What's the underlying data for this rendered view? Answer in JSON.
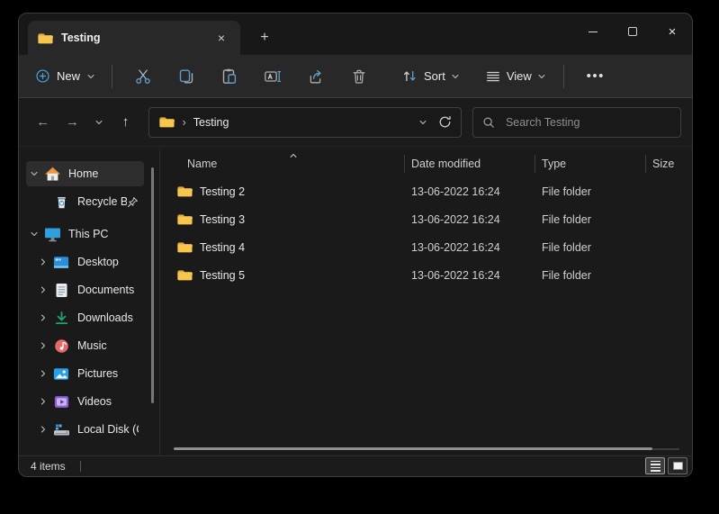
{
  "window": {
    "tab": {
      "title": "Testing",
      "icon": "folder-icon",
      "close_icon": "close-icon",
      "new_tab_icon": "plus-icon"
    },
    "controls": [
      {
        "name": "minimize"
      },
      {
        "name": "maximize"
      },
      {
        "name": "close"
      }
    ]
  },
  "toolbar": {
    "new_label": "New",
    "icon_buttons": [
      {
        "name": "cut"
      },
      {
        "name": "copy"
      },
      {
        "name": "paste"
      },
      {
        "name": "rename"
      },
      {
        "name": "share"
      },
      {
        "name": "delete"
      }
    ],
    "sort_label": "Sort",
    "view_label": "View",
    "more_icon": "see-more-icon"
  },
  "navbar": {
    "back_icon": "back-arrow-icon",
    "forward_icon": "forward-arrow-icon",
    "recent_icon": "recent-locations-chevron-icon",
    "up_icon": "up-arrow-icon",
    "breadcrumb": {
      "root_icon": "folder-icon",
      "separator": "›",
      "location": "Testing"
    },
    "address_dropdown_icon": "chevron-down-icon",
    "refresh_icon": "refresh-icon",
    "search": {
      "icon": "search-icon",
      "placeholder": "Search Testing"
    }
  },
  "sidebar": {
    "items": [
      {
        "label": "Home",
        "icon": "home-icon",
        "chevron": "down",
        "indent": 0,
        "selected": true,
        "pinned": false
      },
      {
        "label": "Recycle Bin",
        "icon": "recycle-bin-icon",
        "chevron": null,
        "indent": 1,
        "selected": false,
        "pinned": true
      },
      {
        "label": "This PC",
        "icon": "this-pc-icon",
        "chevron": "down",
        "indent": 0,
        "selected": false,
        "pinned": false,
        "section_gap": true
      },
      {
        "label": "Desktop",
        "icon": "desktop-icon",
        "chevron": "right",
        "indent": 1,
        "selected": false,
        "pinned": false
      },
      {
        "label": "Documents",
        "icon": "documents-icon",
        "chevron": "right",
        "indent": 1,
        "selected": false,
        "pinned": false
      },
      {
        "label": "Downloads",
        "icon": "downloads-icon",
        "chevron": "right",
        "indent": 1,
        "selected": false,
        "pinned": false
      },
      {
        "label": "Music",
        "icon": "music-icon",
        "chevron": "right",
        "indent": 1,
        "selected": false,
        "pinned": false
      },
      {
        "label": "Pictures",
        "icon": "pictures-icon",
        "chevron": "right",
        "indent": 1,
        "selected": false,
        "pinned": false
      },
      {
        "label": "Videos",
        "icon": "videos-icon",
        "chevron": "right",
        "indent": 1,
        "selected": false,
        "pinned": false
      },
      {
        "label": "Local Disk (C:)",
        "icon": "local-disk-icon",
        "chevron": "right",
        "indent": 1,
        "selected": false,
        "pinned": false
      }
    ]
  },
  "file_list": {
    "columns": [
      "Name",
      "Date modified",
      "Type",
      "Size"
    ],
    "sort_column": "Name",
    "sort_direction": "ascending",
    "rows": [
      {
        "name": "Testing 2",
        "icon": "folder-icon",
        "date_modified": "13-06-2022 16:24",
        "type": "File folder",
        "size": ""
      },
      {
        "name": "Testing 3",
        "icon": "folder-icon",
        "date_modified": "13-06-2022 16:24",
        "type": "File folder",
        "size": ""
      },
      {
        "name": "Testing 4",
        "icon": "folder-icon",
        "date_modified": "13-06-2022 16:24",
        "type": "File folder",
        "size": ""
      },
      {
        "name": "Testing 5",
        "icon": "folder-icon",
        "date_modified": "13-06-2022 16:24",
        "type": "File folder",
        "size": ""
      }
    ]
  },
  "statusbar": {
    "items_label": "4 items",
    "view_buttons": [
      {
        "name": "details-view",
        "active": true
      },
      {
        "name": "large-icons-view",
        "active": false
      }
    ]
  },
  "colors": {
    "accent_blue": "#5f9cc6",
    "folder_yellow": "#f7c64e",
    "window_bg": "#1c1c1c",
    "toolbar_bg": "#282828",
    "selected_item_bg": "#2d2d2d"
  }
}
